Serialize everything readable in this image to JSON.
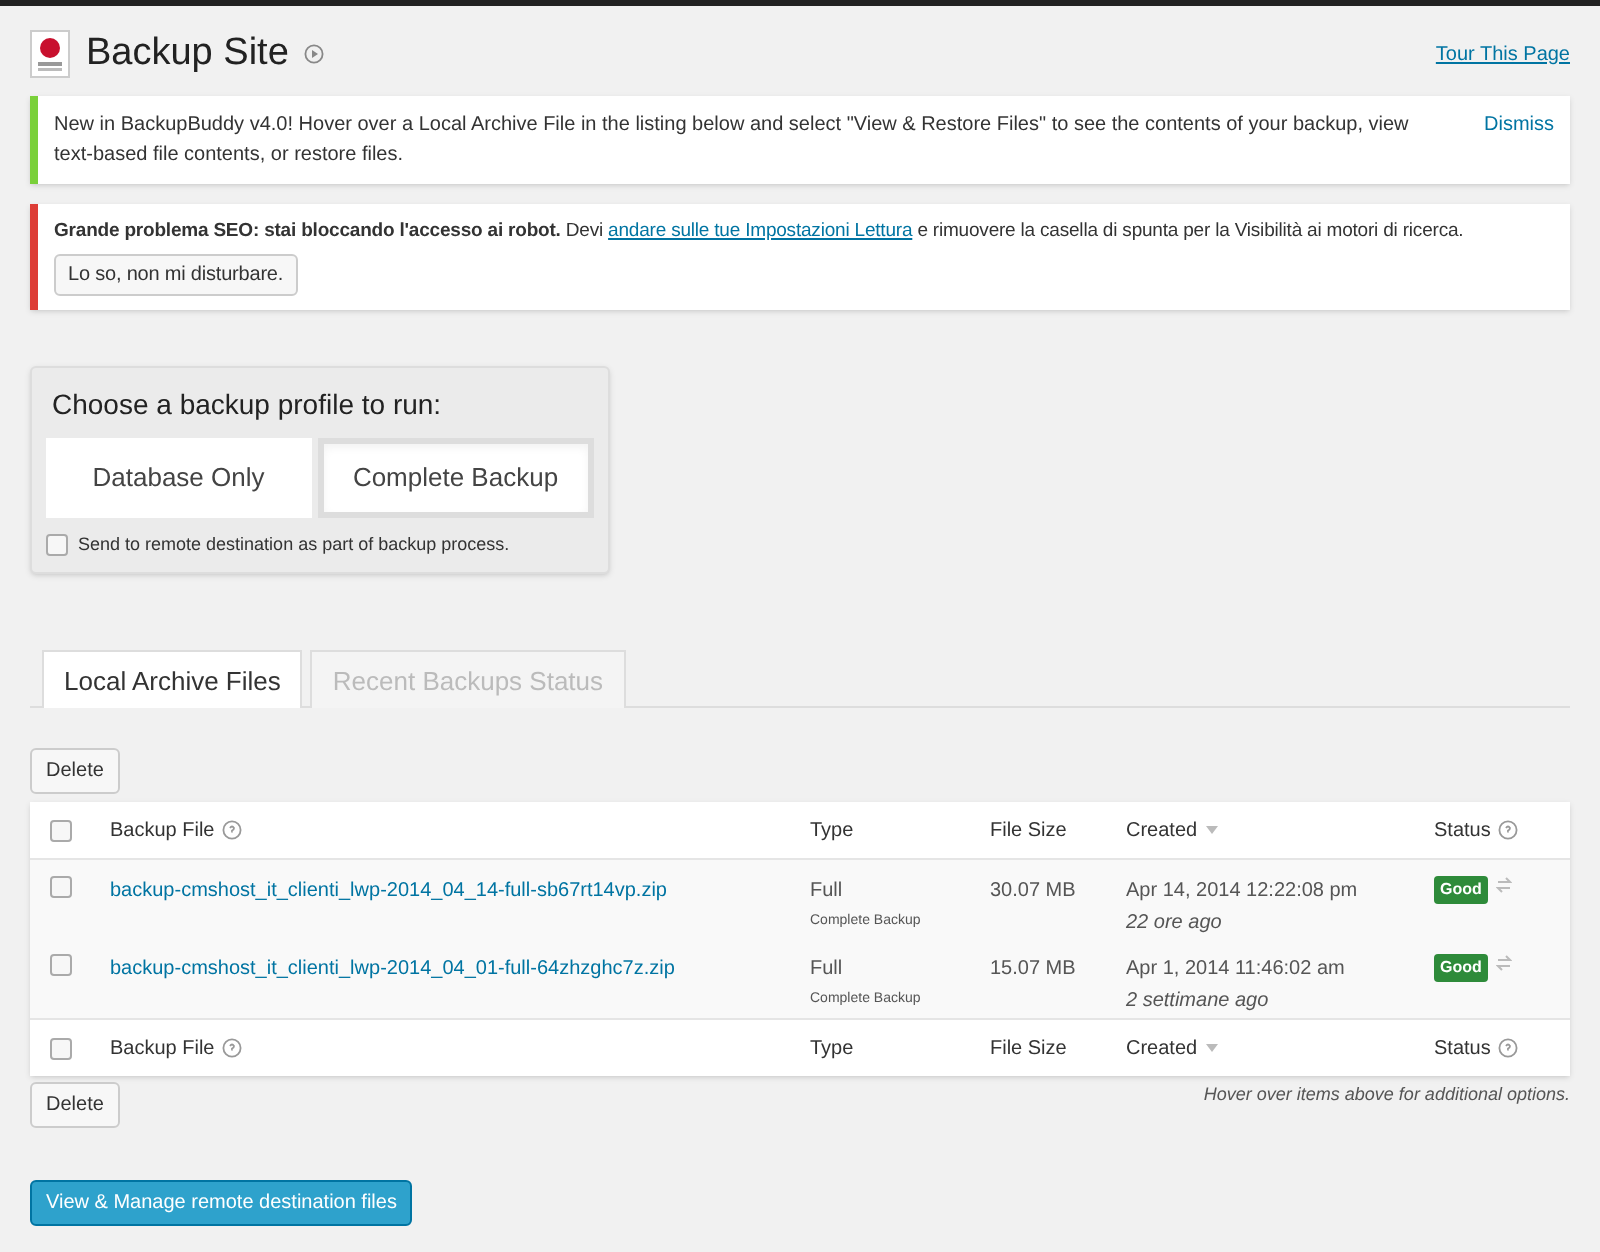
{
  "header": {
    "title": "Backup Site",
    "tour_link": "Tour This Page"
  },
  "notices": [
    {
      "kind": "info",
      "text": "New in BackupBuddy v4.0! Hover over a Local Archive File in the listing below and select \"View & Restore Files\" to see the contents of your backup, view text-based file contents, or restore files.",
      "dismiss": "Dismiss"
    },
    {
      "kind": "error",
      "lead": "Grande problema SEO: stai bloccando l'accesso ai robot.",
      "before_link": "Devi",
      "link": "andare sulle tue Impostazioni Lettura",
      "after_link": "e rimuovere la casella di spunta per la Visibilità ai motori di ricerca.",
      "button": "Lo so, non mi disturbare."
    }
  ],
  "profile_box": {
    "title": "Choose a backup profile to run:",
    "profiles": [
      {
        "label": "Database Only",
        "selected": false
      },
      {
        "label": "Complete Backup",
        "selected": true
      }
    ],
    "remote_option": {
      "label": "Send to remote destination as part of backup process.",
      "checked": false
    }
  },
  "tabs": [
    {
      "label": "Local Archive Files",
      "selected": true
    },
    {
      "label": "Recent Backups Status",
      "selected": false
    }
  ],
  "delete_button": "Delete",
  "table": {
    "columns": [
      "Backup File",
      "Type",
      "File Size",
      "Created",
      "Status"
    ],
    "rows": [
      {
        "file": "backup-cmshost_it_clienti_lwp-2014_04_14-full-sb67rt14vp.zip",
        "type": "Full",
        "subtype": "Complete Backup",
        "size": "30.07 MB",
        "created": "Apr 14, 2014 12:22:08 pm",
        "ago": "22 ore ago",
        "status": "Good",
        "checked": false
      },
      {
        "file": "backup-cmshost_it_clienti_lwp-2014_04_01-full-64zhzghc7z.zip",
        "type": "Full",
        "subtype": "Complete Backup",
        "size": "15.07 MB",
        "created": "Apr 1, 2014 11:46:02 am",
        "ago": "2 settimane ago",
        "status": "Good",
        "checked": false
      }
    ],
    "header_checked": false,
    "footer_columns": [
      "Backup File",
      "Type",
      "File Size",
      "Created",
      "Status"
    ],
    "footer_checked": false
  },
  "hint": "Hover over items above for additional options.",
  "bottom_delete_button": "Delete",
  "remote_button": "View & Manage remote destination files"
}
